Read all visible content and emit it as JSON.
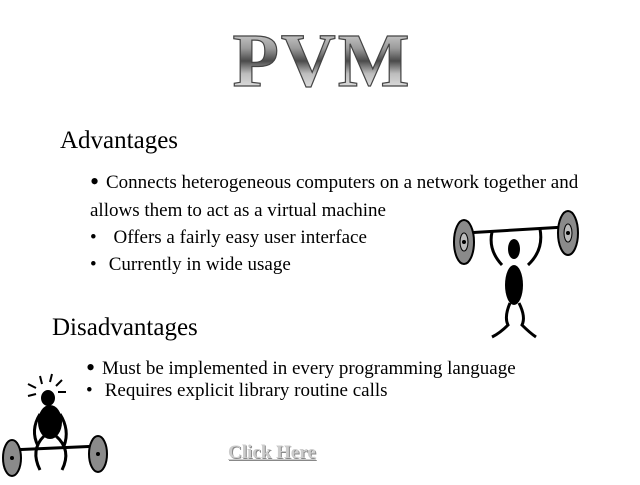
{
  "title": "PVM",
  "advantages": {
    "heading": "Advantages",
    "items": [
      "Connects heterogeneous computers on a network together and allows them to act as a virtual machine",
      "Offers a fairly easy user interface",
      "Currently in wide usage"
    ]
  },
  "disadvantages": {
    "heading": "Disadvantages",
    "items": [
      "Must be implemented in every programming language",
      "Requires explicit library routine calls"
    ]
  },
  "link": {
    "label": "Click Here"
  },
  "icons": {
    "right": "weightlifter-icon",
    "left": "weightlifter-struggling-icon"
  },
  "colors": {
    "text": "#000000",
    "link": "#cccccc",
    "title_light": "#eeeeee",
    "title_dark": "#555555"
  }
}
